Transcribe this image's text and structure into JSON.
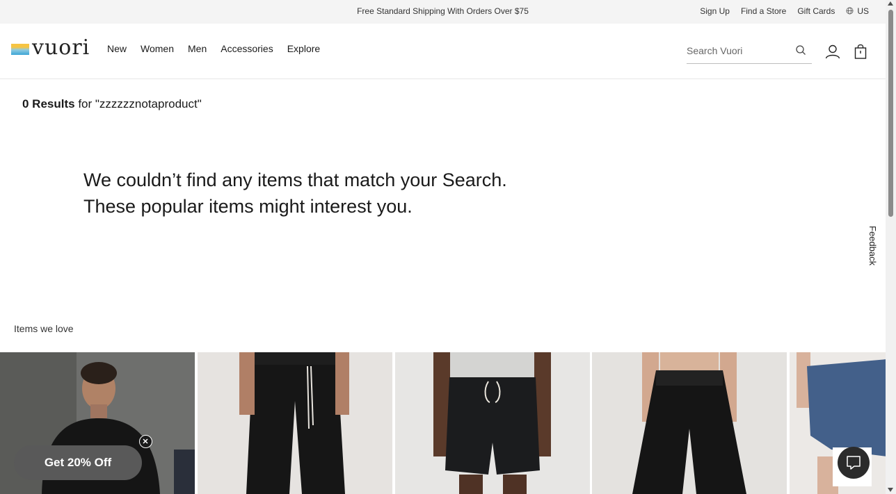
{
  "topbar": {
    "promo": "Free Standard Shipping With Orders Over $75",
    "links": {
      "sign_up": "Sign Up",
      "find_store": "Find a Store",
      "gift_cards": "Gift Cards",
      "region": "US"
    }
  },
  "header": {
    "logo_text": "vuori",
    "nav": {
      "new": "New",
      "women": "Women",
      "men": "Men",
      "accessories": "Accessories",
      "explore": "Explore"
    },
    "search": {
      "placeholder": "Search Vuori",
      "value": ""
    }
  },
  "results": {
    "count": "0 Results",
    "for_text": " for \"zzzzzznotaproduct\""
  },
  "no_match": {
    "line1": "We couldn’t find any items that match your Search.",
    "line2": "These popular items might interest you."
  },
  "feedback_label": "Feedback",
  "items_section": {
    "title": "Items we love"
  },
  "promo_pill": {
    "label": "Get 20% Off"
  },
  "colors": {
    "topbar_bg": "#f4f4f4",
    "pill_bg": "#595959",
    "chat_bg": "#2b2b2b"
  }
}
